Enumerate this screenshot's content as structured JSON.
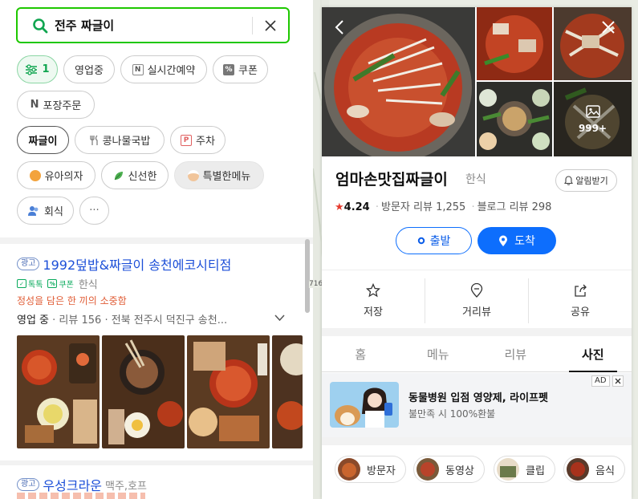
{
  "search": {
    "query": "전주 짜글이"
  },
  "filters": {
    "filter_count": "1",
    "row1": [
      "영업중",
      "실시간예약",
      "쿠폰"
    ],
    "row2": [
      "포장주문"
    ],
    "keywords": [
      "짜글이",
      "콩나물국밥",
      "주차"
    ],
    "moods": [
      "유아의자",
      "신선한",
      "특별한메뉴"
    ],
    "extra": [
      "회식"
    ],
    "more": "···"
  },
  "result1": {
    "ad": "광고",
    "name": "1992덮밥&짜글이 송천에코시티점",
    "talk": "톡톡",
    "coupon": "쿠폰",
    "category": "한식",
    "promo": "정성을 담은 한 끼의 소중함",
    "status": "영업 중",
    "reviews": "리뷰 156",
    "address": "전북 전주시 덕진구 송천..."
  },
  "result2": {
    "ad": "광고",
    "name": "우성크라운",
    "category": "맥주,호프"
  },
  "map": {
    "road_label": "716"
  },
  "place": {
    "name": "엄마손맛집짜글이",
    "category": "한식",
    "alarm": "알림받기",
    "score": "4.24",
    "visitor_reviews": "방문자 리뷰 1,255",
    "blog_reviews": "블로그 리뷰 298",
    "photo_more": "999+",
    "departure": "출발",
    "arrival": "도착",
    "actions": {
      "save": "저장",
      "distance": "거리뷰",
      "share": "공유"
    },
    "tabs": [
      "홈",
      "메뉴",
      "리뷰",
      "사진"
    ],
    "active_tab": "사진",
    "ad": {
      "title": "동물병원 입점 영양제, 라이프펫",
      "sub": "불만족 시 100%환불",
      "label": "AD"
    },
    "photo_filters": [
      "방문자",
      "동영상",
      "클립",
      "음식"
    ]
  },
  "colors": {
    "accent_green": "#1ec800",
    "accent_blue": "#0d6efd",
    "link_blue": "#1c4fd8",
    "star": "#e63c2f"
  }
}
